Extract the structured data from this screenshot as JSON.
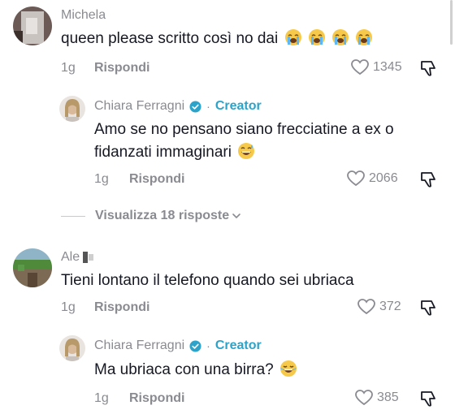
{
  "comments": [
    {
      "username": "Michela",
      "text": "queen please scritto così no dai",
      "time": "1g",
      "reply_label": "Rispondi",
      "likes": "1345",
      "emoji": [
        "loudly-crying-face",
        "loudly-crying-face",
        "loudly-crying-face",
        "loudly-crying-face"
      ]
    },
    {
      "username": "Chiara Ferragni",
      "creator_label": "Creator",
      "dot": "·",
      "text_line1": "Amo se no pensano siano frecciatine a ex o",
      "text_line2": "fidanzati immaginari",
      "time": "1g",
      "reply_label": "Rispondi",
      "likes": "2066",
      "emoji": [
        "grinning-face-with-sweat"
      ]
    },
    {
      "username": "Ale",
      "text": "Tieni lontano il telefono quando sei ubriaca",
      "time": "1g",
      "reply_label": "Rispondi",
      "likes": "372"
    },
    {
      "username": "Chiara Ferragni",
      "creator_label": "Creator",
      "dot": "·",
      "text": "Ma ubriaca con una birra?",
      "time": "1g",
      "reply_label": "Rispondi",
      "likes": "385",
      "emoji": [
        "face-with-tears-of-joy"
      ]
    }
  ],
  "view_replies_label": "Visualizza 18 risposte",
  "colors": {
    "creator": "#2ea3c9",
    "meta": "#8a8b91",
    "text": "#161823"
  }
}
